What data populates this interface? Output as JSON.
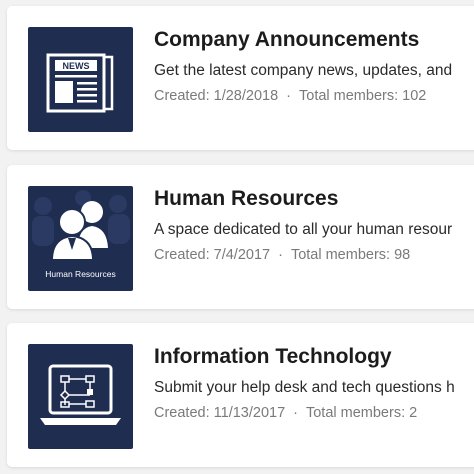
{
  "groups": [
    {
      "title": "Company Announcements",
      "description": "Get the latest company news, updates, and",
      "created": "Created: 1/28/2018",
      "members": "Total members: 102",
      "separator": "·",
      "icon": "newspaper-icon",
      "icon_text": "NEWS"
    },
    {
      "title": "Human Resources",
      "description": "A space dedicated to all your human resour",
      "created": "Created: 7/4/2017",
      "members": "Total members: 98",
      "separator": "·",
      "icon": "people-icon",
      "icon_caption": "Human Resources"
    },
    {
      "title": "Information Technology",
      "description": "Submit your help desk and tech questions h",
      "created": "Created: 11/13/2017",
      "members": "Total members: 2",
      "separator": "·",
      "icon": "laptop-flowchart-icon"
    }
  ],
  "colors": {
    "thumb_bg": "#1f2d50",
    "title": "#1c1c1c",
    "meta": "#7a7a7a"
  }
}
